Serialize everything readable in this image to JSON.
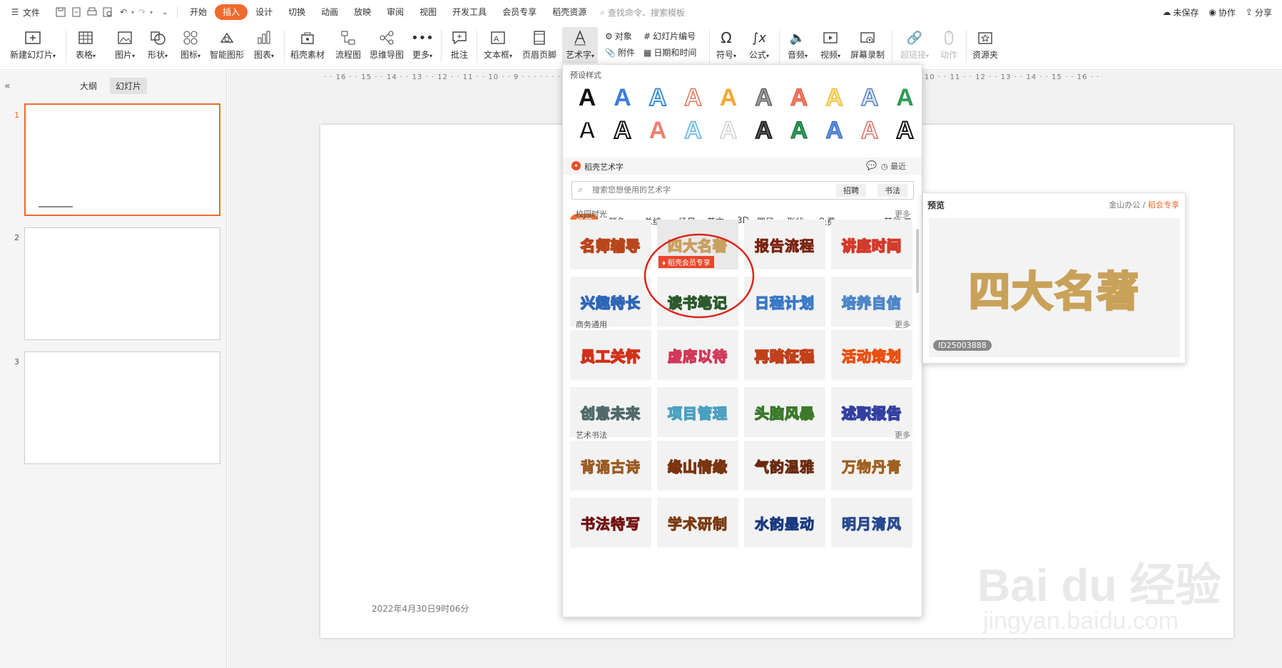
{
  "menu": {
    "file": "文件",
    "tabs": [
      "开始",
      "插入",
      "设计",
      "切换",
      "动画",
      "放映",
      "审阅",
      "视图",
      "开发工具",
      "会员专享",
      "稻壳资源"
    ],
    "search_placeholder": "查找命令、搜索模板",
    "unsaved": "未保存",
    "collab": "协作",
    "share": "分享"
  },
  "ribbon": {
    "new_slide": "新建幻灯片",
    "table": "表格",
    "picture": "图片",
    "shape": "形状",
    "icon": "图标",
    "smart": "智能图形",
    "chart": "图表",
    "docer": "稻壳素材",
    "flow": "流程图",
    "mind": "思维导图",
    "more": "更多",
    "comment": "批注",
    "textbox": "文本框",
    "header": "页眉页脚",
    "wordart": "艺术字",
    "object": "对象",
    "attach": "附件",
    "slide_num": "幻灯片编号",
    "datetime": "日期和时间",
    "symbol": "符号",
    "formula": "公式",
    "audio": "音频",
    "video": "视频",
    "record": "屏幕录制",
    "hyperlink": "超链接",
    "action": "动作",
    "resource": "资源夹"
  },
  "left": {
    "outline": "大纲",
    "slides": "幻灯片",
    "nums": [
      "1",
      "2",
      "3"
    ]
  },
  "ruler": "· · 16 · · 15 · · 14 · · 13 · · 12 · · 11 · · 10 · · 9 · · · · · · · · · · · · · · · · · · · · · · · · · · · · · · · · · · · · · · · · · · · · · · · · · · · · · · 6 · · 7 · · 8 · · 9 · · 10 · · 11 · · 12 · · 13 · · 14 · · 15 · · 16 · ·",
  "slide": {
    "date": "2022年4月30日9时06分"
  },
  "panel": {
    "preset_title": "预设样式",
    "glyph": "A",
    "docer_title": "稻壳艺术字",
    "recent": "最近",
    "search_placeholder": "搜索您想使用的艺术字",
    "btn_recruit": "招聘",
    "btn_calli": "书法",
    "cats": [
      "极简",
      "颜色",
      "总结",
      "场景",
      "英文",
      "3D",
      "国风",
      "形状",
      "免费"
    ],
    "other": "其他",
    "vip_badge": "稻壳会员专享",
    "sections": [
      {
        "title": "校园时光",
        "more": "更多",
        "items": [
          "名师辅导",
          "四大名著",
          "报告流程",
          "讲座时间",
          "兴趣特长",
          "读书笔记",
          "日程计划",
          "培养自信"
        ]
      },
      {
        "title": "商务通用",
        "more": "更多",
        "items": [
          "员工关怀",
          "虚席以待",
          "再踏征程",
          "活动策划",
          "创意未来",
          "项目管理",
          "头脑风暴",
          "述职报告"
        ]
      },
      {
        "title": "艺术书法",
        "more": "更多",
        "items": [
          "背诵古诗",
          "缘山情缘",
          "气韵温雅",
          "万物丹青",
          "书法特写",
          "学术研制",
          "水韵墨动",
          "明月清风"
        ]
      }
    ]
  },
  "preview": {
    "title": "预览",
    "brand": "金山办公",
    "vip": "稻会专享",
    "text": "四大名著",
    "id": "ID25003888"
  },
  "watermark": {
    "main": "Bai du 经验",
    "url": "jingyan.baidu.com"
  },
  "colors": {
    "accent": "#f06a2d",
    "annotation": "#d9261c"
  }
}
